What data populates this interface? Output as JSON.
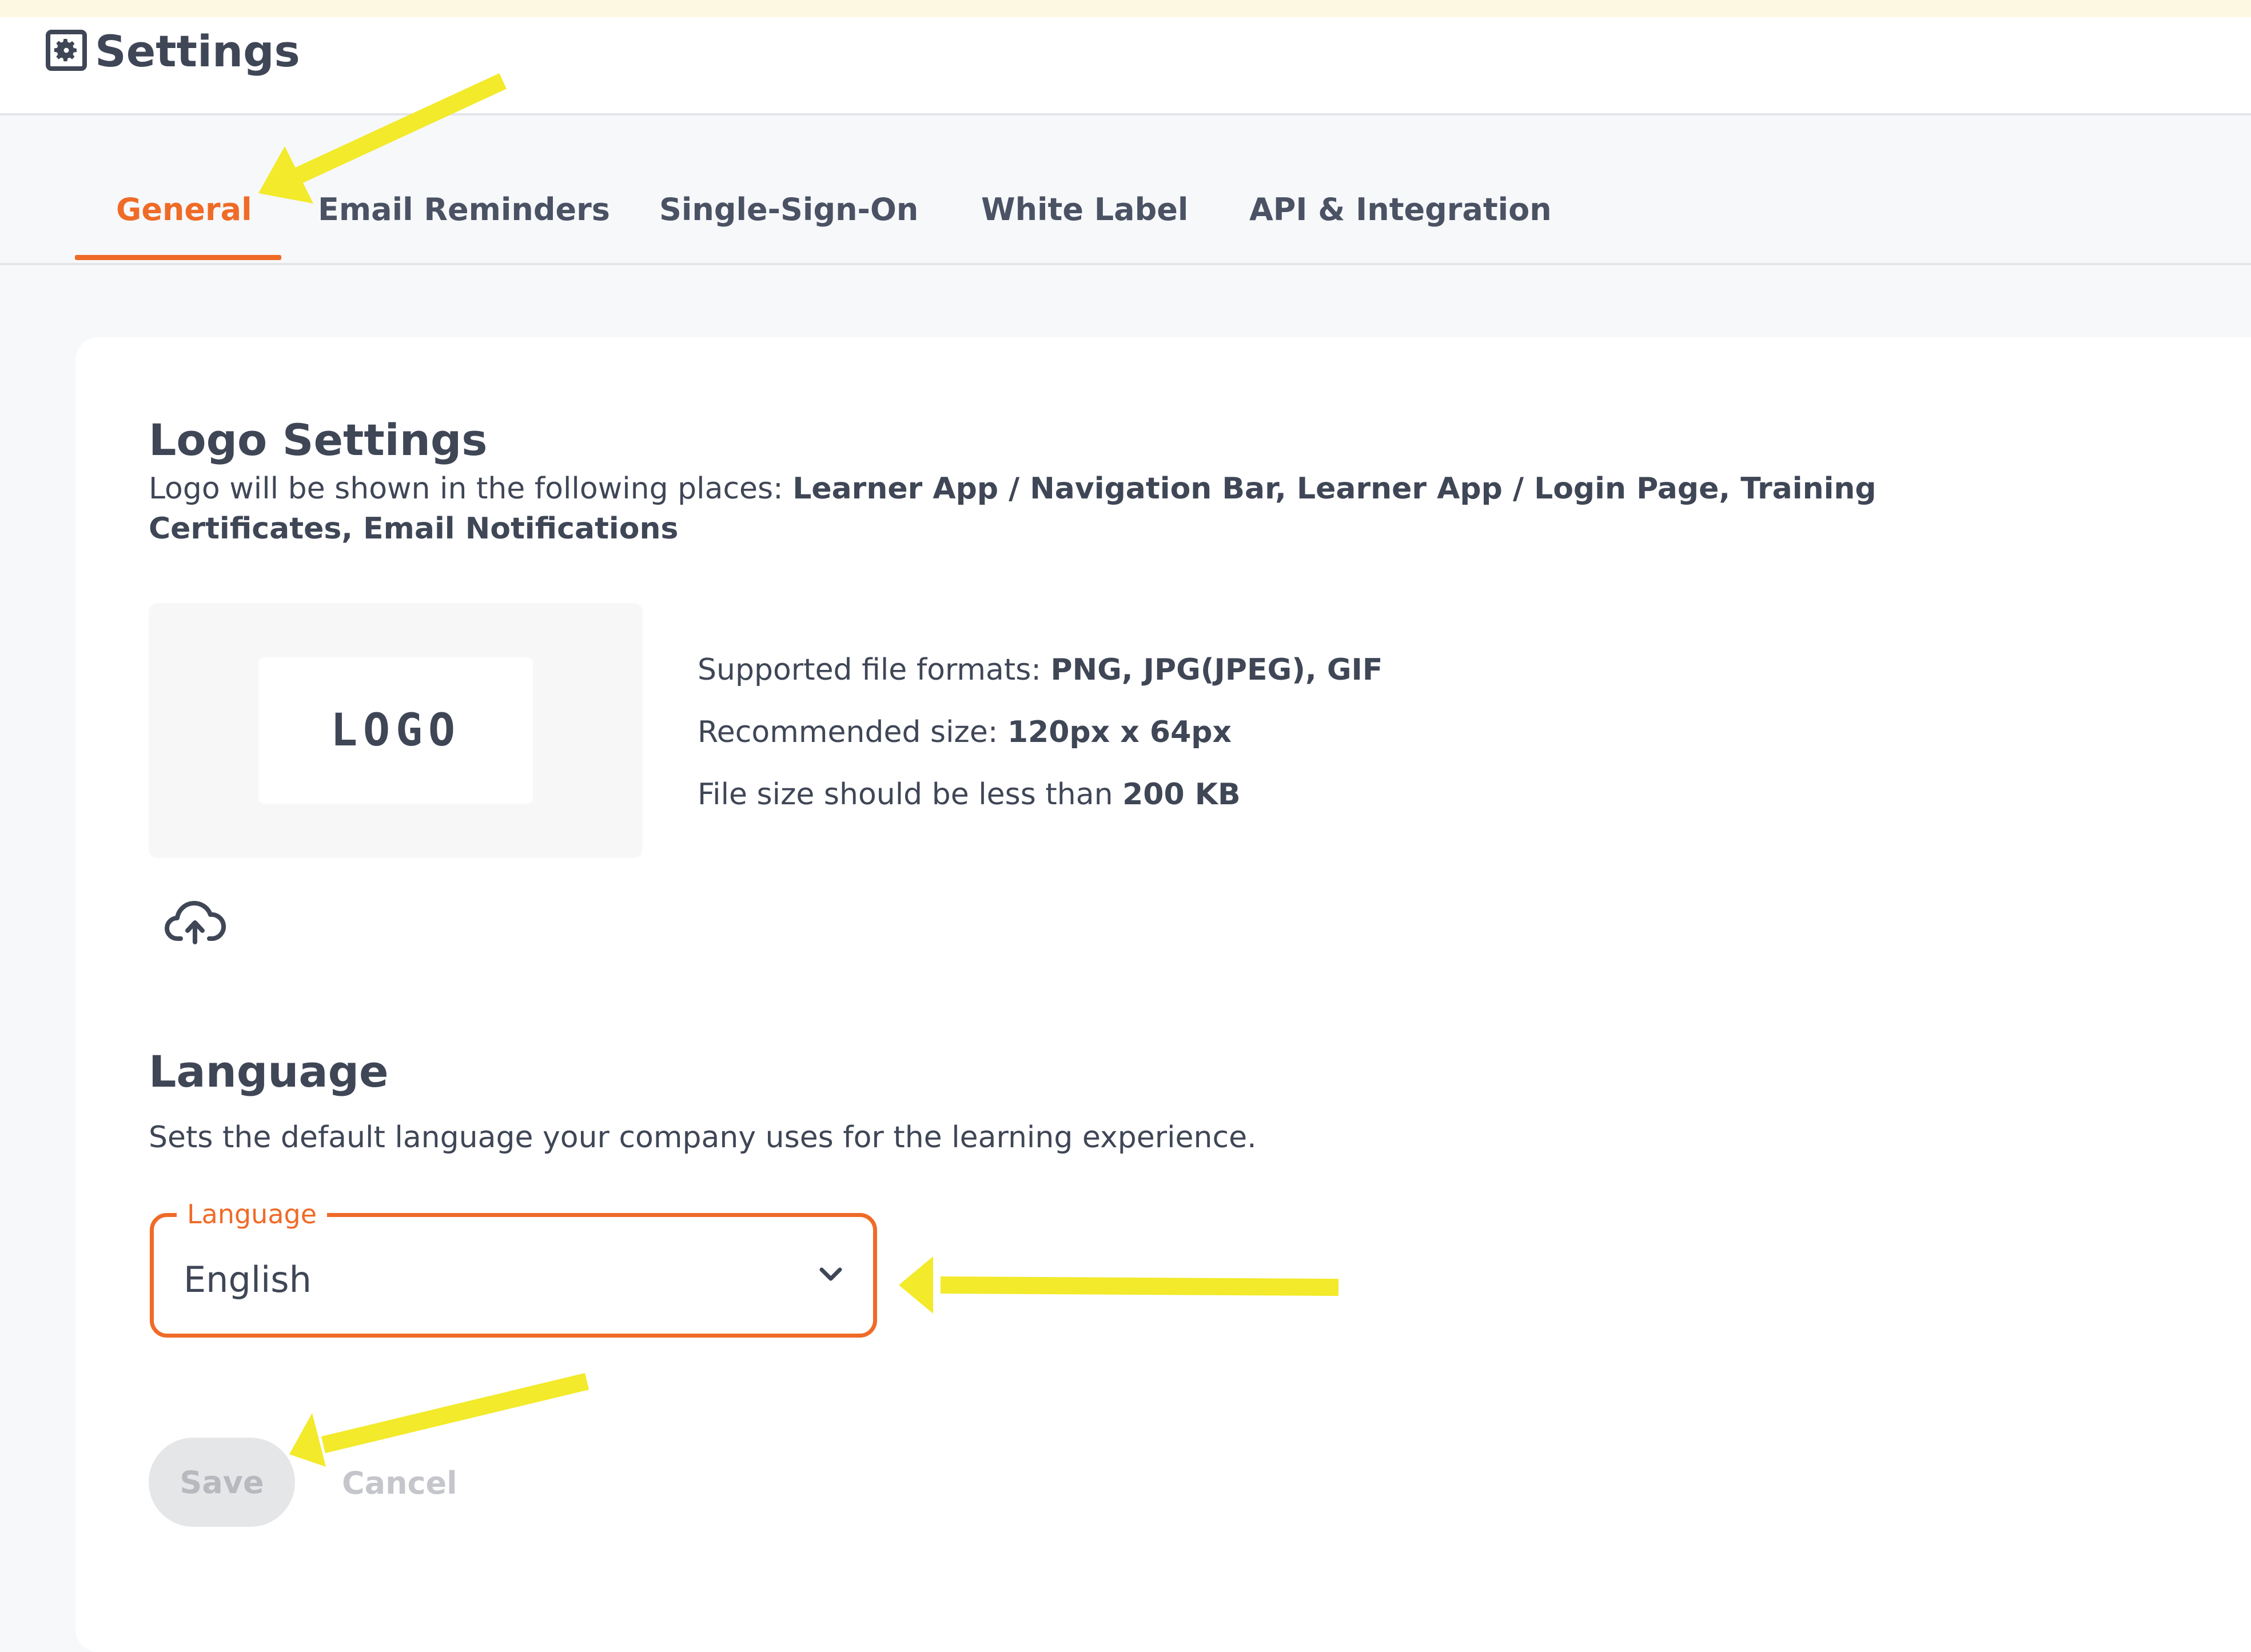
{
  "header": {
    "title": "Settings",
    "icon": "gear-icon"
  },
  "tabs": [
    {
      "label": "General",
      "active": true
    },
    {
      "label": "Email Reminders",
      "active": false
    },
    {
      "label": "Single-Sign-On",
      "active": false
    },
    {
      "label": "White Label",
      "active": false
    },
    {
      "label": "API & Integration",
      "active": false
    }
  ],
  "logo_settings": {
    "title": "Logo Settings",
    "description_prefix": "Logo will be shown in the following places: ",
    "description_places_line1": "Learner App / Navigation Bar, Learner App / Login Page, Training",
    "description_places_line2": "Certificates, Email Notifications",
    "logo_placeholder": "LOGO",
    "formats_label": "Supported file formats: ",
    "formats_value": "PNG, JPG(JPEG), GIF",
    "size_label": "Recommended size: ",
    "size_value": "120px x 64px",
    "filesize_label": "File size should be less than ",
    "filesize_value": "200 KB",
    "upload_icon": "cloud-upload-icon"
  },
  "language": {
    "title": "Language",
    "description": "Sets the default language your company uses for the learning experience.",
    "field_label": "Language",
    "selected_value": "English"
  },
  "actions": {
    "save_label": "Save",
    "cancel_label": "Cancel"
  },
  "colors": {
    "accent": "#ef6b28",
    "annotation_arrow": "#f2ea2a",
    "text": "#3f4656"
  }
}
